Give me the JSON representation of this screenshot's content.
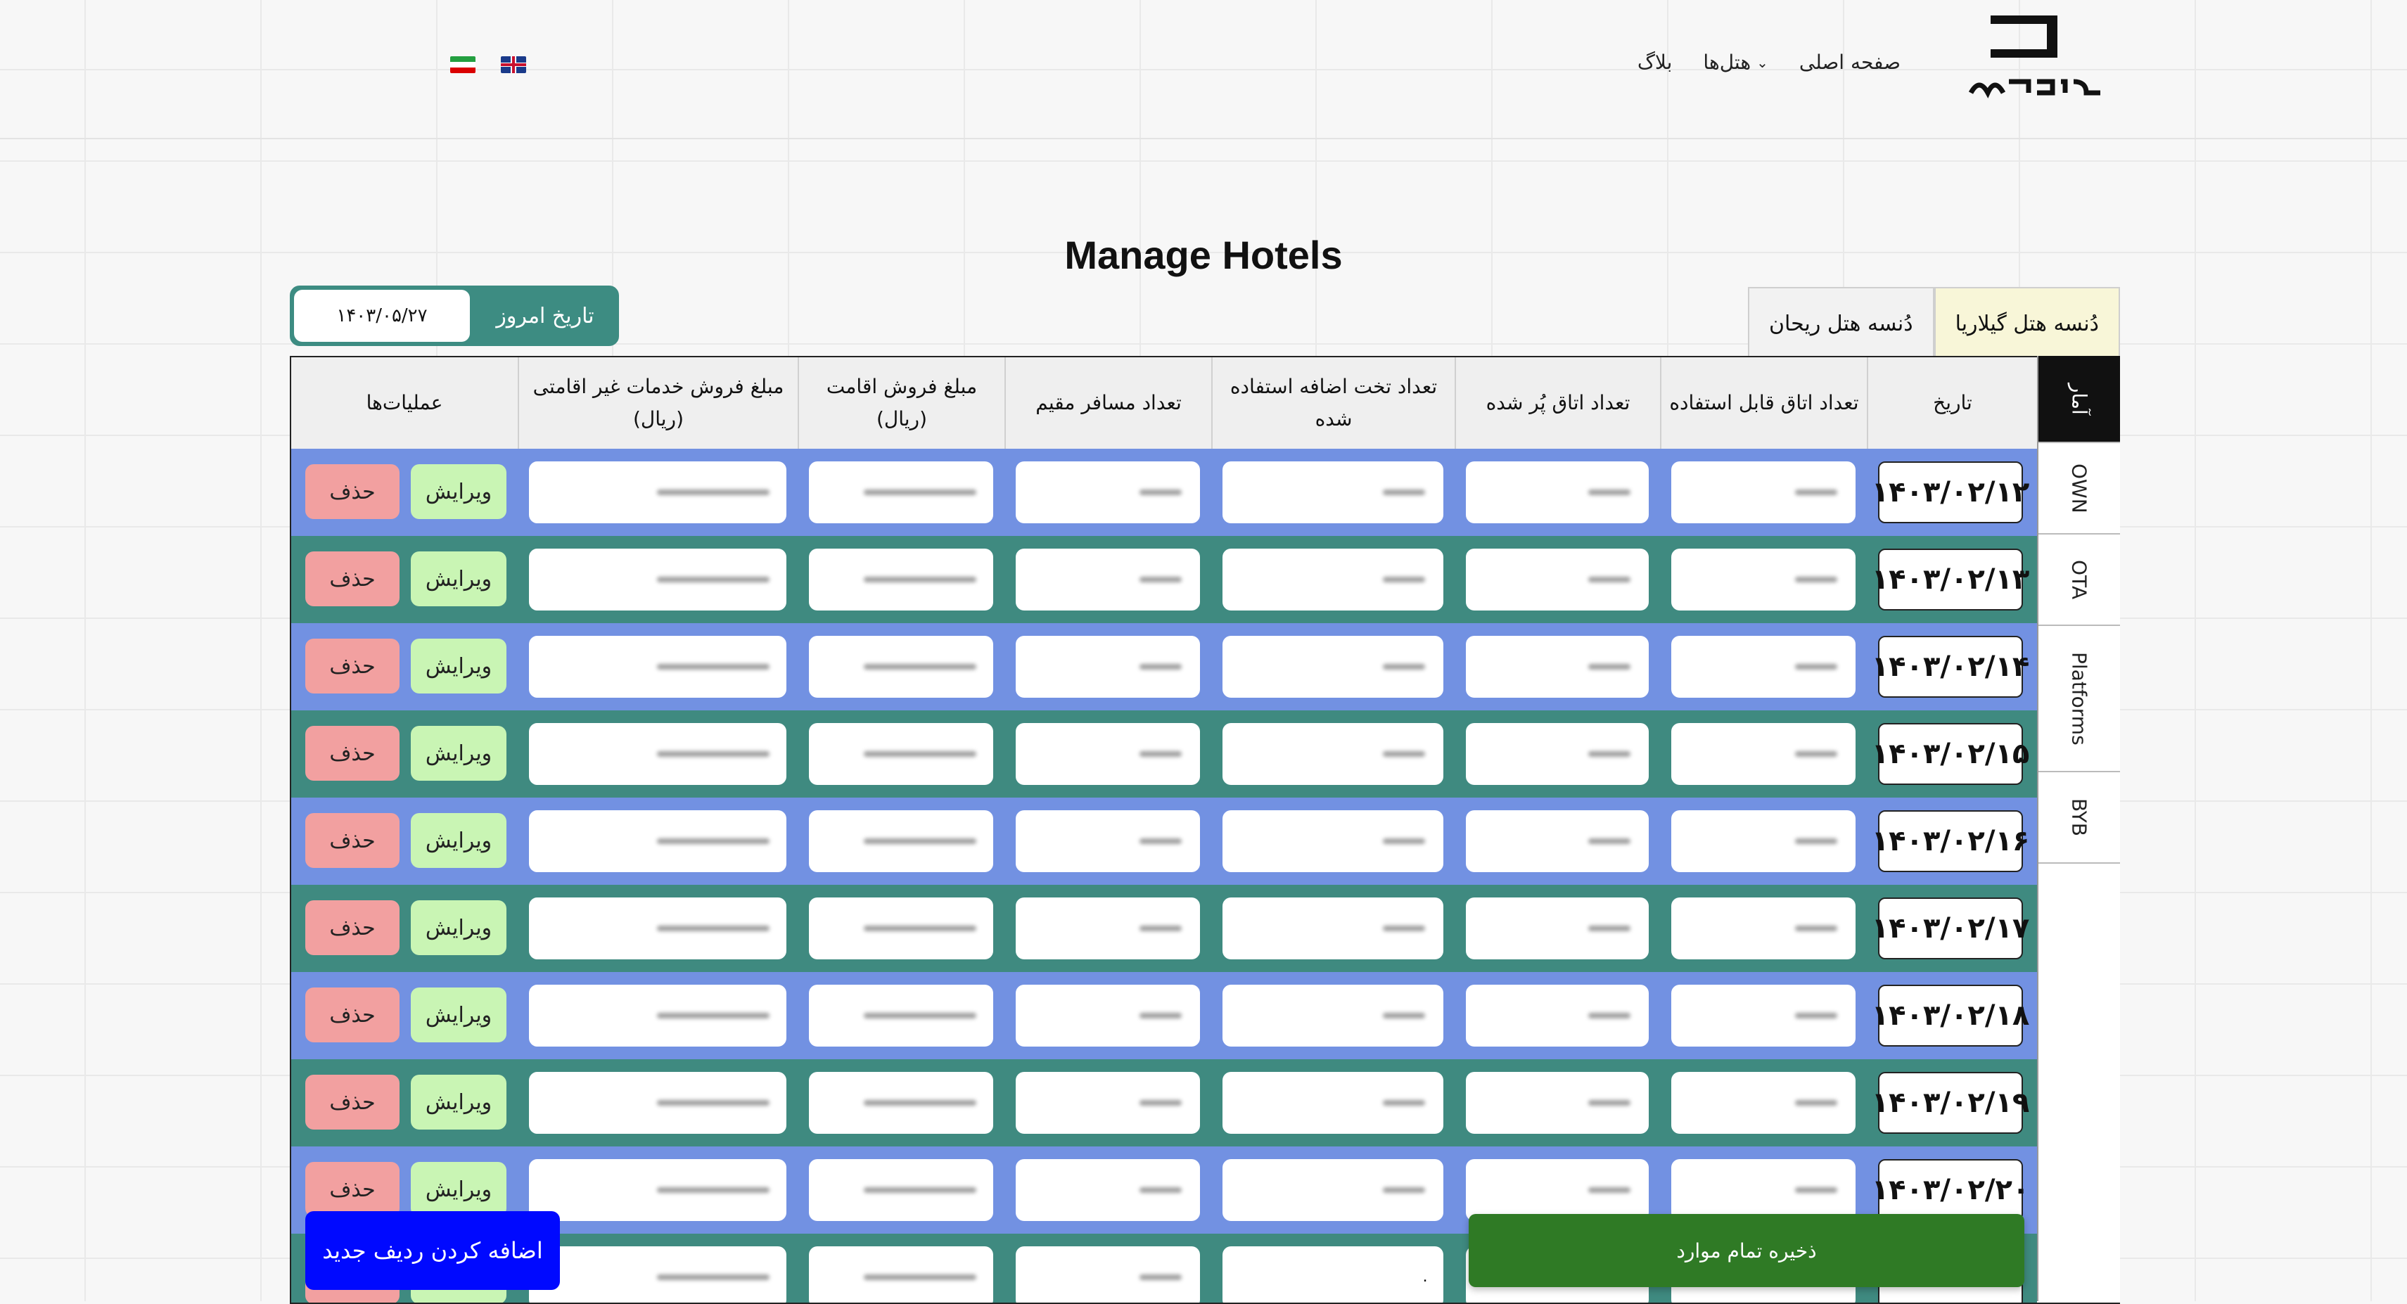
{
  "header": {
    "nav": [
      {
        "label": "صفحه اصلی",
        "has_chevron": false
      },
      {
        "label": "هتل‌ها",
        "has_chevron": true
      },
      {
        "label": "بلاگ",
        "has_chevron": false
      }
    ],
    "languages": [
      "fa-flag-icon",
      "en-flag-icon"
    ]
  },
  "page_title": "Manage Hotels",
  "today": {
    "label": "تاریخ امروز",
    "value": "۱۴۰۳/۰۵/۲۷"
  },
  "hotel_tabs": [
    {
      "label": "دُنسه هتل گیلاریا",
      "active": true
    },
    {
      "label": "دُنسه هتل ریحان",
      "active": false
    }
  ],
  "side_tabs": [
    {
      "label": "آمار",
      "active": true
    },
    {
      "label": "OWN",
      "active": false
    },
    {
      "label": "OTA",
      "active": false
    },
    {
      "label": "Platforms",
      "active": false
    },
    {
      "label": "BYB",
      "active": false
    }
  ],
  "table": {
    "columns": [
      "تاریخ",
      "تعداد اتاق قابل استفاده",
      "تعداد اتاق پُر شده",
      "تعداد تخت اضافه استفاده شده",
      "تعداد مسافر مقیم",
      "مبلغ فروش اقامت (ریال)",
      "مبلغ فروش خدمات غیر اقامتی (ریال)",
      "عملیات‌ها"
    ],
    "rows": [
      {
        "date": "۱۴۰۳/۰۲/۱۲"
      },
      {
        "date": "۱۴۰۳/۰۲/۱۳"
      },
      {
        "date": "۱۴۰۳/۰۲/۱۴"
      },
      {
        "date": "۱۴۰۳/۰۲/۱۵"
      },
      {
        "date": "۱۴۰۳/۰۲/۱۶"
      },
      {
        "date": "۱۴۰۳/۰۲/۱۷"
      },
      {
        "date": "۱۴۰۳/۰۲/۱۸"
      },
      {
        "date": "۱۴۰۳/۰۲/۱۹"
      },
      {
        "date": "۱۴۰۳/۰۲/۲۰"
      }
    ],
    "last_row_extra_bed_value": "۰",
    "edit_label": "ویرایش",
    "delete_label": "حذف"
  },
  "actions": {
    "add_row": "اضافه کردن ردیف جدید",
    "save_all": "ذخیره تمام موارد"
  },
  "colors": {
    "row_blue": "#7291e2",
    "row_teal": "#3f8a80",
    "add_button": "#0009ff",
    "save_button": "#2f7a25",
    "edit_button": "#c9f5b4",
    "delete_button": "#f2a0a0"
  }
}
